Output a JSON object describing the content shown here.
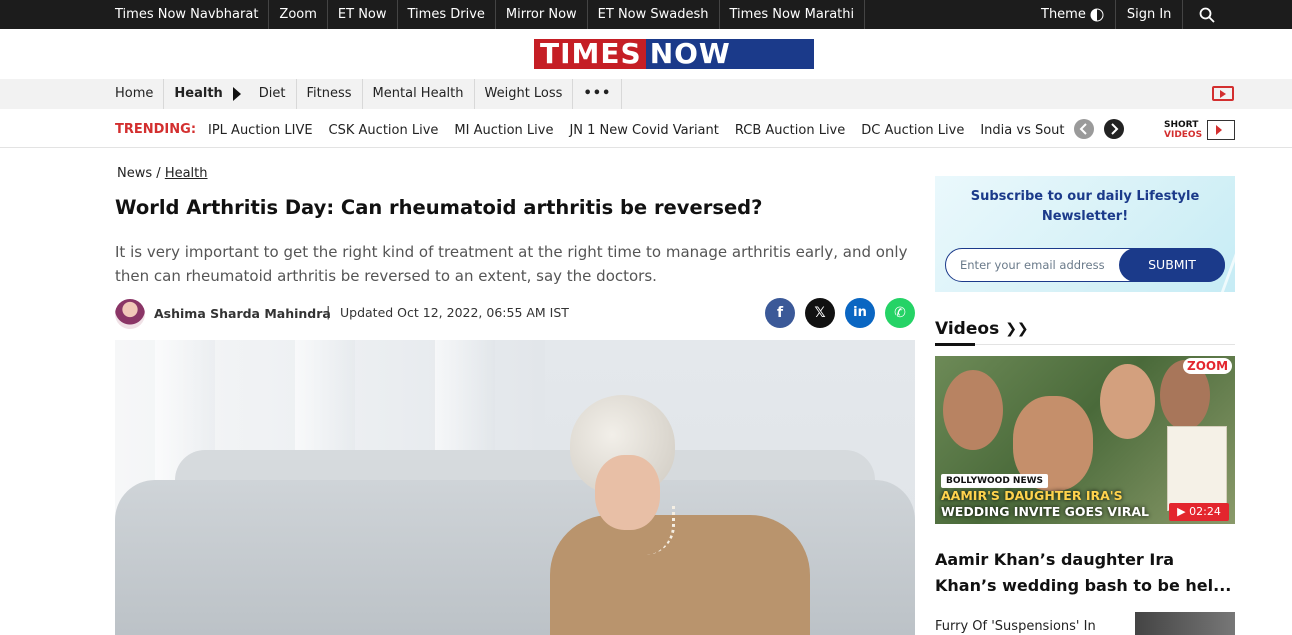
{
  "topbar": {
    "links": [
      "Times Now Navbharat",
      "Zoom",
      "ET Now",
      "Times Drive",
      "Mirror Now",
      "ET Now Swadesh",
      "Times Now Marathi"
    ],
    "theme_label": "Theme",
    "signin_label": "Sign In"
  },
  "logo": {
    "part1": "TIMES",
    "part2": "NOW",
    "colors": {
      "red": "#c51e25",
      "blue": "#1b3a8a"
    }
  },
  "nav": {
    "items": [
      "Home",
      "Health",
      "Diet",
      "Fitness",
      "Mental Health",
      "Weight Loss"
    ],
    "active": "Health",
    "more_label": "•••"
  },
  "trending": {
    "label": "TRENDING:",
    "items": [
      "IPL Auction LIVE",
      "CSK Auction Live",
      "MI Auction Live",
      "JN 1 New Covid Variant",
      "RCB Auction Live",
      "DC Auction Live",
      "India vs South Africa"
    ],
    "shorts_top": "SHORT",
    "shorts_bottom": "VIDEOS"
  },
  "article": {
    "breadcrumb_root": "News",
    "breadcrumb_sep": "/",
    "breadcrumb_section": "Health",
    "headline": "World Arthritis Day: Can rheumatoid arthritis be reversed?",
    "summary": "It is very important to get the right kind of treatment at the right time to manage arthritis early, and only then can rheumatoid arthritis be reversed to an extent, say the doctors.",
    "author": "Ashima Sharda Mahindra",
    "separator": "|",
    "updated": "Updated Oct 12, 2022, 06:55 AM IST",
    "share": [
      {
        "name": "facebook",
        "glyph": "f",
        "color": "#3b5998"
      },
      {
        "name": "x",
        "glyph": "𝕏",
        "color": "#111111"
      },
      {
        "name": "linkedin",
        "glyph": "in",
        "color": "#0a66c2"
      },
      {
        "name": "whatsapp",
        "glyph": "✆",
        "color": "#25d366"
      }
    ]
  },
  "newsletter": {
    "title": "Subscribe to our daily Lifestyle Newsletter!",
    "placeholder": "Enter your email address",
    "submit_label": "SUBMIT"
  },
  "videos": {
    "heading": "Videos",
    "chevron": "❯❯",
    "badge": "ZOOM",
    "category": "BOLLYWOOD NEWS",
    "caption_line1": "AAMIR'S DAUGHTER IRA'S",
    "caption_line2": "WEDDING INVITE GOES VIRAL",
    "duration": "▶ 02:24",
    "title": "Aamir Khan’s daughter Ira Khan’s wedding bash to be hel...",
    "next_item": "Furry Of 'Suspensions' In"
  }
}
